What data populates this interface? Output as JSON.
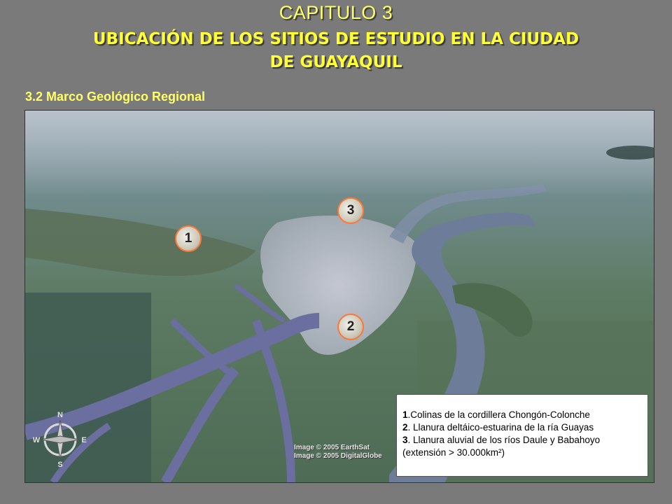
{
  "header": {
    "chapter": "CAPITULO 3",
    "title_line1": "UBICACIÓN DE LOS SITIOS DE ESTUDIO EN LA CIUDAD",
    "title_line2": "DE GUAYAQUIL",
    "section": "3.2 Marco Geológico Regional"
  },
  "map": {
    "markers": [
      {
        "label": "1"
      },
      {
        "label": "2"
      },
      {
        "label": "3"
      }
    ],
    "credits": [
      "Image © 2005 EarthSat",
      "Image © 2005 DigitalGlobe"
    ],
    "compass": {
      "n": "N",
      "e": "E",
      "s": "S",
      "w": "W"
    },
    "colors": {
      "marker_border": "#ff7733",
      "title": "#ffff66",
      "water": "#5d6f95",
      "land": "#5f7a5e",
      "city": "#b9bccb"
    }
  },
  "legend": {
    "items": [
      {
        "num": "1",
        "text": ".Colinas de la cordillera Chongón-Colonche"
      },
      {
        "num": "2",
        "text": ". Llanura deltáico-estuarina de la ría Guayas"
      },
      {
        "num": "3",
        "text": ". Llanura aluvial de los ríos Daule y Babahoyo"
      }
    ],
    "extra": "(extensión > 30.000km²)"
  }
}
